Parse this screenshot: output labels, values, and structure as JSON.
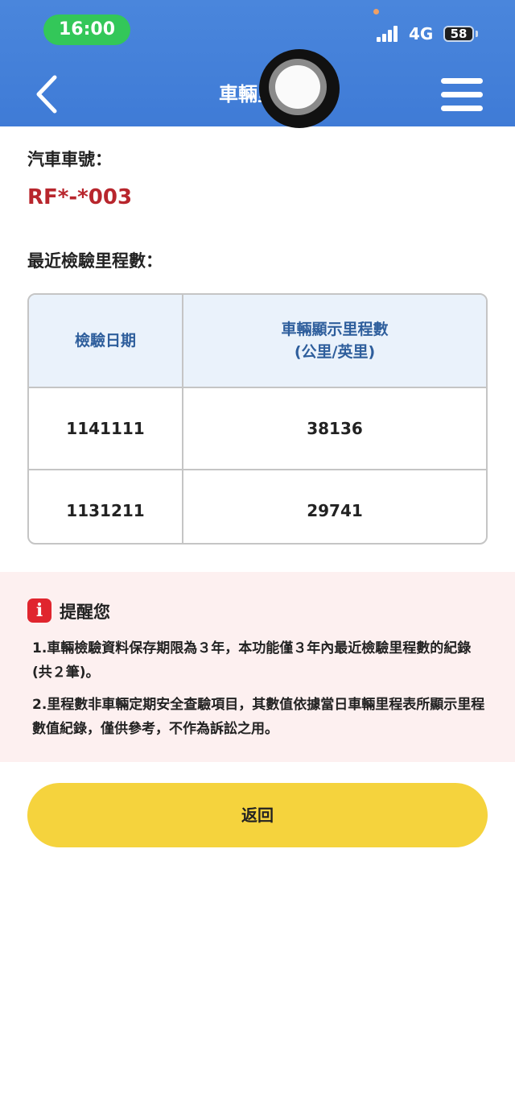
{
  "status_bar": {
    "time": "16:00",
    "network": "4G",
    "battery": "58"
  },
  "header": {
    "title": "車輛里程",
    "back_icon": "chevron-left-icon",
    "menu_icon": "hamburger-menu-icon",
    "accent_color": "#4a86dc"
  },
  "vehicle": {
    "plate_label": "汽車車號：",
    "plate_number": "RF*-*003"
  },
  "mileage": {
    "section_label": "最近檢驗里程數：",
    "columns": [
      "檢驗日期",
      "車輛顯示里程數",
      "(公里/英里)"
    ],
    "rows": [
      [
        "1141111",
        "38136"
      ],
      [
        "1131211",
        "29741"
      ]
    ]
  },
  "reminder": {
    "icon": "info-icon",
    "title": "提醒您",
    "notes": [
      "1.車輛檢驗資料保存期限為３年，本功能僅３年內最近檢驗里程數的紀錄 (共２筆)。",
      "2.里程數非車輛定期安全查驗項目，其數值依據當日車輛里程表所顯示里程數值紀錄，僅供參考，不作為訴訟之用。"
    ]
  },
  "actions": {
    "return_label": "返回",
    "button_color": "#f5d33d"
  }
}
